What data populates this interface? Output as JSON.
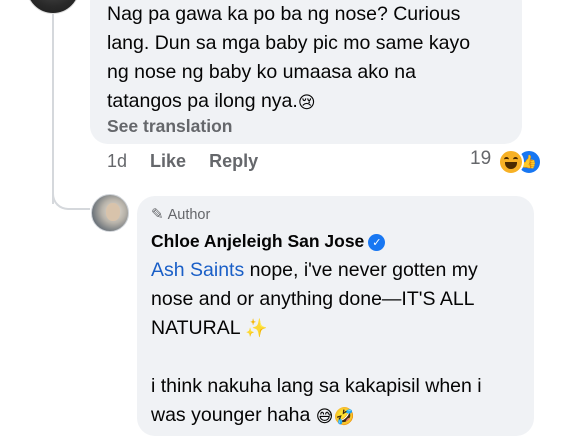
{
  "comment": {
    "lines": [
      "Nag pa gawa ka po ba ng nose? Curious",
      "lang. Dun sa mga baby pic mo same kayo",
      "ng nose ng baby ko  umaasa ako na",
      "tatangos pa ilong nya."
    ],
    "emoji": "😢",
    "see_translation": "See translation",
    "time": "1d",
    "like_label": "Like",
    "reply_label": "Reply",
    "reaction_count": "19",
    "reactions": [
      "haha-icon",
      "like-icon"
    ]
  },
  "reply": {
    "author_badge": "Author",
    "author_name": "Chloe Anjeleigh San Jose",
    "mention": "Ash Saints",
    "line1_rest": " nope, i've never gotten my",
    "line2": "nose and or anything done—IT'S ALL",
    "line3": "NATURAL",
    "sparkles": "✨",
    "line4": "i think nakuha lang sa kakapisil when i",
    "line5": "was younger haha",
    "end_emojis": "😅🤣"
  },
  "colors": {
    "bubble": "#f0f2f5",
    "secondary_text": "#65676b",
    "mention_link": "#1a5fc7",
    "verified_blue": "#1877f2"
  }
}
